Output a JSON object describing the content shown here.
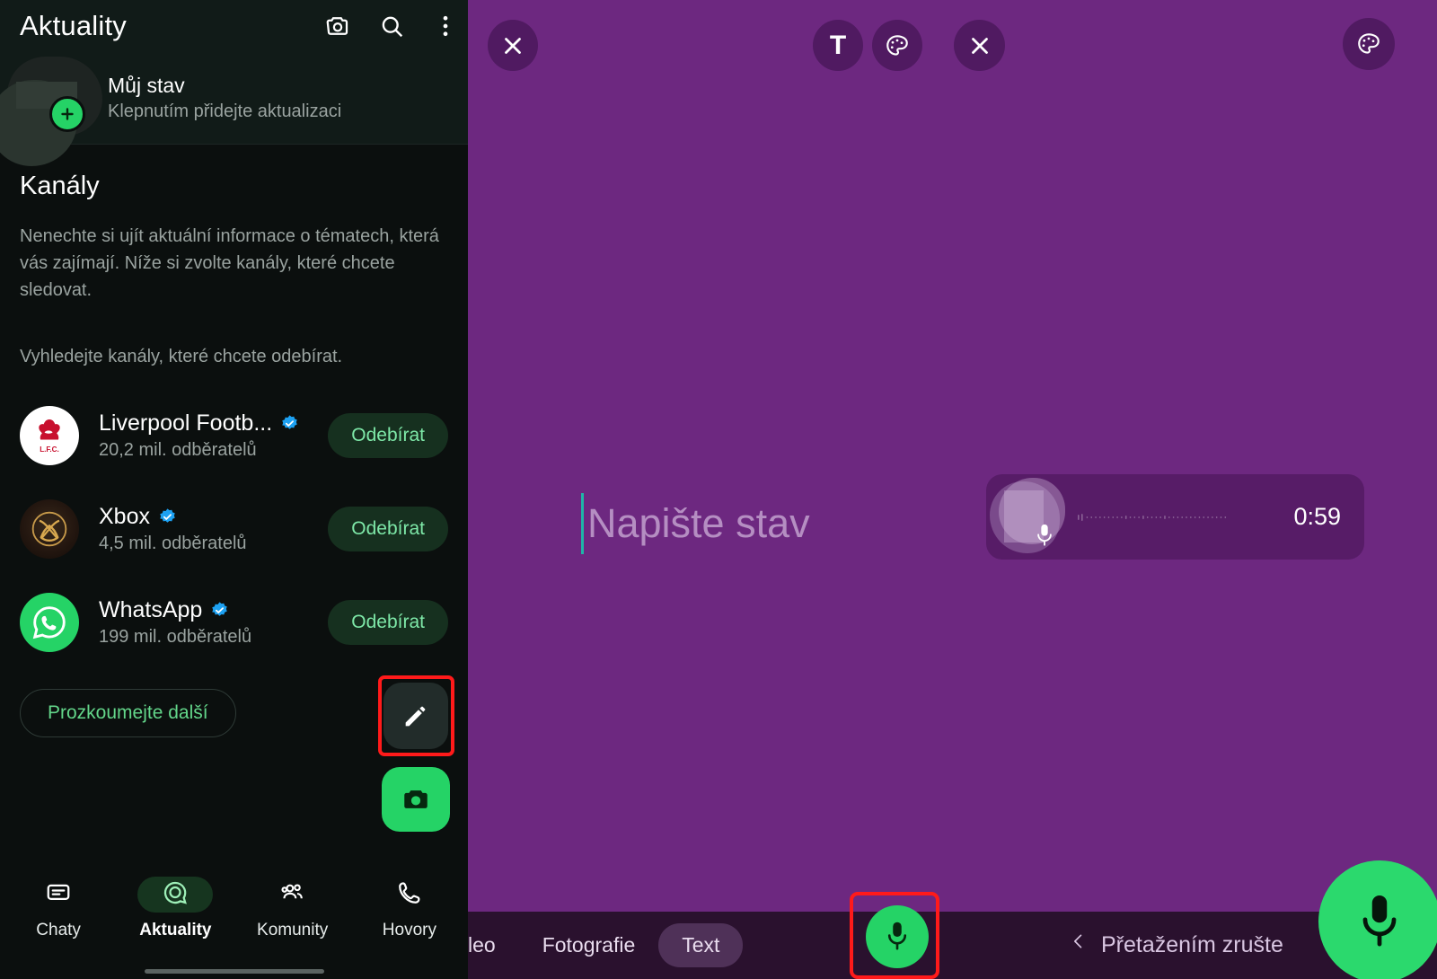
{
  "left_panel": {
    "app_bar": {
      "title": "Aktuality",
      "icons": [
        "camera-icon",
        "search-icon",
        "overflow-menu-icon"
      ]
    },
    "my_status": {
      "title": "Můj stav",
      "subtitle": "Klepnutím přidejte aktualizaci",
      "add_badge": "plus-icon"
    },
    "channels": {
      "heading": "Kanály",
      "description": "Nenechte si ujít aktuální informace o tématech, která vás zajímají. Níže si zvolte kanály, které chcete sledovat.",
      "search_hint": "Vyhledejte kanály, které chcete odebírat.",
      "items": [
        {
          "name": "Liverpool Footb...",
          "subscribers": "20,2 mil. odběratelů",
          "verified": true,
          "button": "Odebírat",
          "avatar": "liverpool-fc-logo"
        },
        {
          "name": "Xbox",
          "subscribers": "4,5 mil. odběratelů",
          "verified": true,
          "button": "Odebírat",
          "avatar": "xbox-logo"
        },
        {
          "name": "WhatsApp",
          "subscribers": "199 mil. odběratelů",
          "verified": true,
          "button": "Odebírat",
          "avatar": "whatsapp-logo"
        }
      ],
      "explore_button": "Prozkoumejte další"
    },
    "fabs": {
      "edit": "edit-pencil-icon",
      "camera": "camera-icon"
    },
    "bottom_nav": [
      {
        "label": "Chaty",
        "icon": "chats-icon",
        "active": false
      },
      {
        "label": "Aktuality",
        "icon": "updates-icon",
        "active": true
      },
      {
        "label": "Komunity",
        "icon": "communities-icon",
        "active": false
      },
      {
        "label": "Hovory",
        "icon": "calls-icon",
        "active": false
      }
    ]
  },
  "right_panel": {
    "background_color": "#6d2880",
    "top_controls": [
      {
        "name": "close-left",
        "icon": "close-icon"
      },
      {
        "name": "text-tool",
        "icon": "text-T-icon",
        "glyph": "T"
      },
      {
        "name": "palette-middle",
        "icon": "palette-icon"
      },
      {
        "name": "close-middle",
        "icon": "close-icon"
      },
      {
        "name": "palette-right",
        "icon": "palette-icon"
      }
    ],
    "composer": {
      "placeholder": "Napište stav",
      "value": ""
    },
    "recorder_pill": {
      "time": "0:59",
      "mic_icon": "mic-icon"
    },
    "bottom_bar": {
      "mode_tabs": [
        {
          "label": "leo",
          "active": false
        },
        {
          "label": "Fotografie",
          "active": false
        },
        {
          "label": "Text",
          "active": true
        }
      ],
      "record_button": {
        "icon": "mic-icon",
        "highlighted": true
      },
      "cancel_hint": {
        "chevron": "chevron-left-icon",
        "label": "Přetažením zrušte"
      },
      "mic_fab": {
        "icon": "mic-icon"
      }
    }
  },
  "colors": {
    "purple_bg": "#6d2880",
    "bottom_bar_bg": "#2a112e",
    "whatsapp_green": "#25d366",
    "highlight_red": "#ff1a1a",
    "subscribe_bg": "#16301f",
    "subscribe_text": "#7ee8a8"
  }
}
